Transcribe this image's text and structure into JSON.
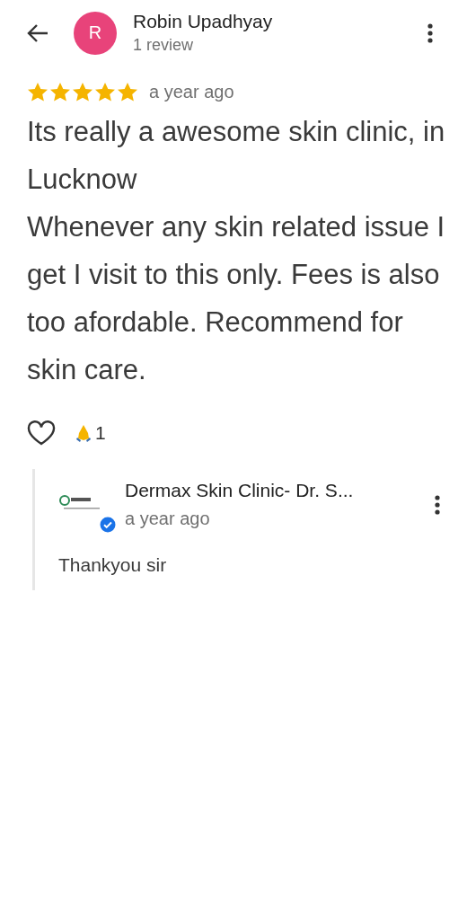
{
  "reviewer": {
    "initial": "R",
    "name": "Robin Upadhyay",
    "review_count": "1 review"
  },
  "review": {
    "stars": 5,
    "time": "a year ago",
    "text": "Its really a awesome skin clinic, in Lucknow\nWhenever any skin related issue I get I visit to this only. Fees is also too afordable. Recommend for skin care."
  },
  "reactions": {
    "liked": false,
    "count": "1"
  },
  "owner_reply": {
    "name": "Dermax Skin Clinic- Dr. S...",
    "verified": true,
    "time": "a year ago",
    "text": "Thankyou sir"
  }
}
